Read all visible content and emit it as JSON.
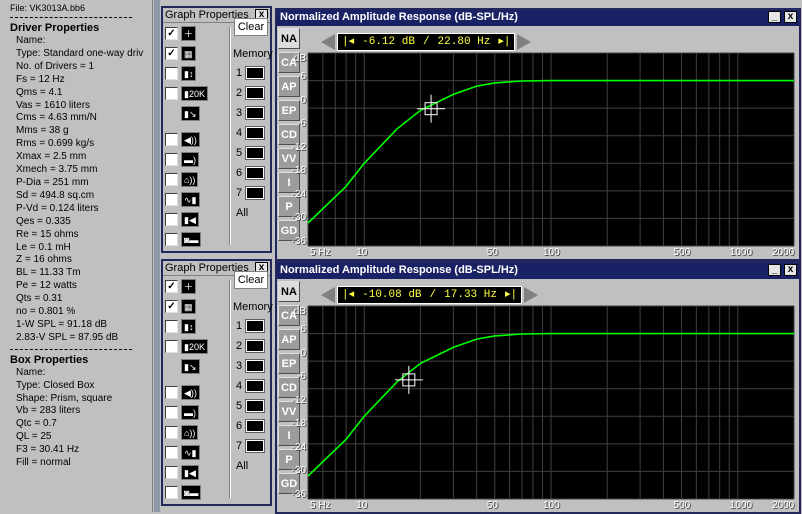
{
  "file_label": "File: VK3013A.bb6",
  "driver": {
    "title": "Driver Properties",
    "rows": [
      "Name:",
      "Type: Standard one-way driv",
      "No. of Drivers = 1",
      "Fs = 12 Hz",
      "Qms = 4.1",
      "Vas = 1610 liters",
      "Cms = 4.63 mm/N",
      "Mms = 38 g",
      "Rms = 0.699 kg/s",
      "Xmax = 2.5 mm",
      "Xmech = 3.75 mm",
      "P-Dia = 251 mm",
      "Sd = 494.8 sq.cm",
      "P-Vd = 0.124 liters",
      "Qes = 0.335",
      "Re = 15 ohms",
      "Le = 0.1 mH",
      "Z = 16 ohms",
      "BL = 11.33 Tm",
      "Pe = 12 watts",
      "Qts = 0.31",
      "no = 0.801 %",
      "1-W SPL = 91.18 dB",
      "2.83-V SPL = 87.95 dB"
    ]
  },
  "box": {
    "title": "Box Properties",
    "rows": [
      "Name:",
      "Type: Closed Box",
      "Shape: Prism, square",
      "Vb = 283 liters",
      "Qtc = 0.7",
      "QL = 25",
      "F3 = 30.41 Hz",
      "Fill = normal"
    ]
  },
  "graph_props": {
    "title": "Graph Properties",
    "clear_label": "Clear",
    "memory_label": "Memory",
    "memory_slots": [
      "1",
      "2",
      "3",
      "4",
      "5",
      "6",
      "7",
      "All"
    ],
    "close_glyph": "x",
    "checkmark": "✓",
    "icons": [
      "plus-icon",
      "grid-icon",
      "vertical-scale-icon",
      "20k-icon",
      "corner-icon",
      "speaker-icon",
      "driver-icon",
      "house-icon",
      "waveform-icon",
      "amp-icon",
      "camera-icon",
      "graph-icon"
    ],
    "icon_text_20k": "20K"
  },
  "graph": {
    "title": "Normalized Amplitude Response (dB-SPL/Hz)",
    "tabs": [
      "NA",
      "CA",
      "AP",
      "EP",
      "CD",
      "VV",
      "I",
      "P",
      "GD"
    ],
    "y_unit": "dB",
    "y_ticks": [
      "6",
      "0",
      "-6",
      "-12",
      "-18",
      "-24",
      "-30",
      "-36"
    ],
    "x_ticks": [
      "5 Hz",
      "10",
      "50",
      "100",
      "500",
      "1000",
      "2000"
    ],
    "line_color": "#00ff00"
  },
  "graphs": [
    {
      "readout_db": "-6.12 dB",
      "readout_hz": "22.80 Hz",
      "marker_hz": 22.8,
      "marker_db": -6.12
    },
    {
      "readout_db": "-10.08 dB",
      "readout_hz": "17.33 Hz",
      "marker_hz": 17.33,
      "marker_db": -10.08
    }
  ],
  "chart_data": [
    {
      "type": "line",
      "title": "Normalized Amplitude Response (dB-SPL/Hz)",
      "x_scale": "log",
      "xlim": [
        5,
        2000
      ],
      "ylim": [
        -36,
        6
      ],
      "x": [
        5,
        8,
        10,
        15,
        20,
        30,
        40,
        50,
        70,
        100,
        200,
        500,
        1000,
        2000
      ],
      "y": [
        -31,
        -23,
        -18,
        -10.5,
        -6.5,
        -3,
        -1.2,
        -0.5,
        -0.1,
        0,
        0,
        0,
        0,
        0
      ]
    },
    {
      "type": "line",
      "title": "Normalized Amplitude Response (dB-SPL/Hz)",
      "x_scale": "log",
      "xlim": [
        5,
        2000
      ],
      "ylim": [
        -36,
        6
      ],
      "x": [
        5,
        8,
        10,
        15,
        20,
        30,
        40,
        50,
        70,
        100,
        200,
        500,
        1000,
        2000
      ],
      "y": [
        -31,
        -23,
        -18,
        -10.5,
        -6.5,
        -3,
        -1.2,
        -0.5,
        -0.1,
        0,
        0,
        0,
        0,
        0
      ]
    }
  ]
}
